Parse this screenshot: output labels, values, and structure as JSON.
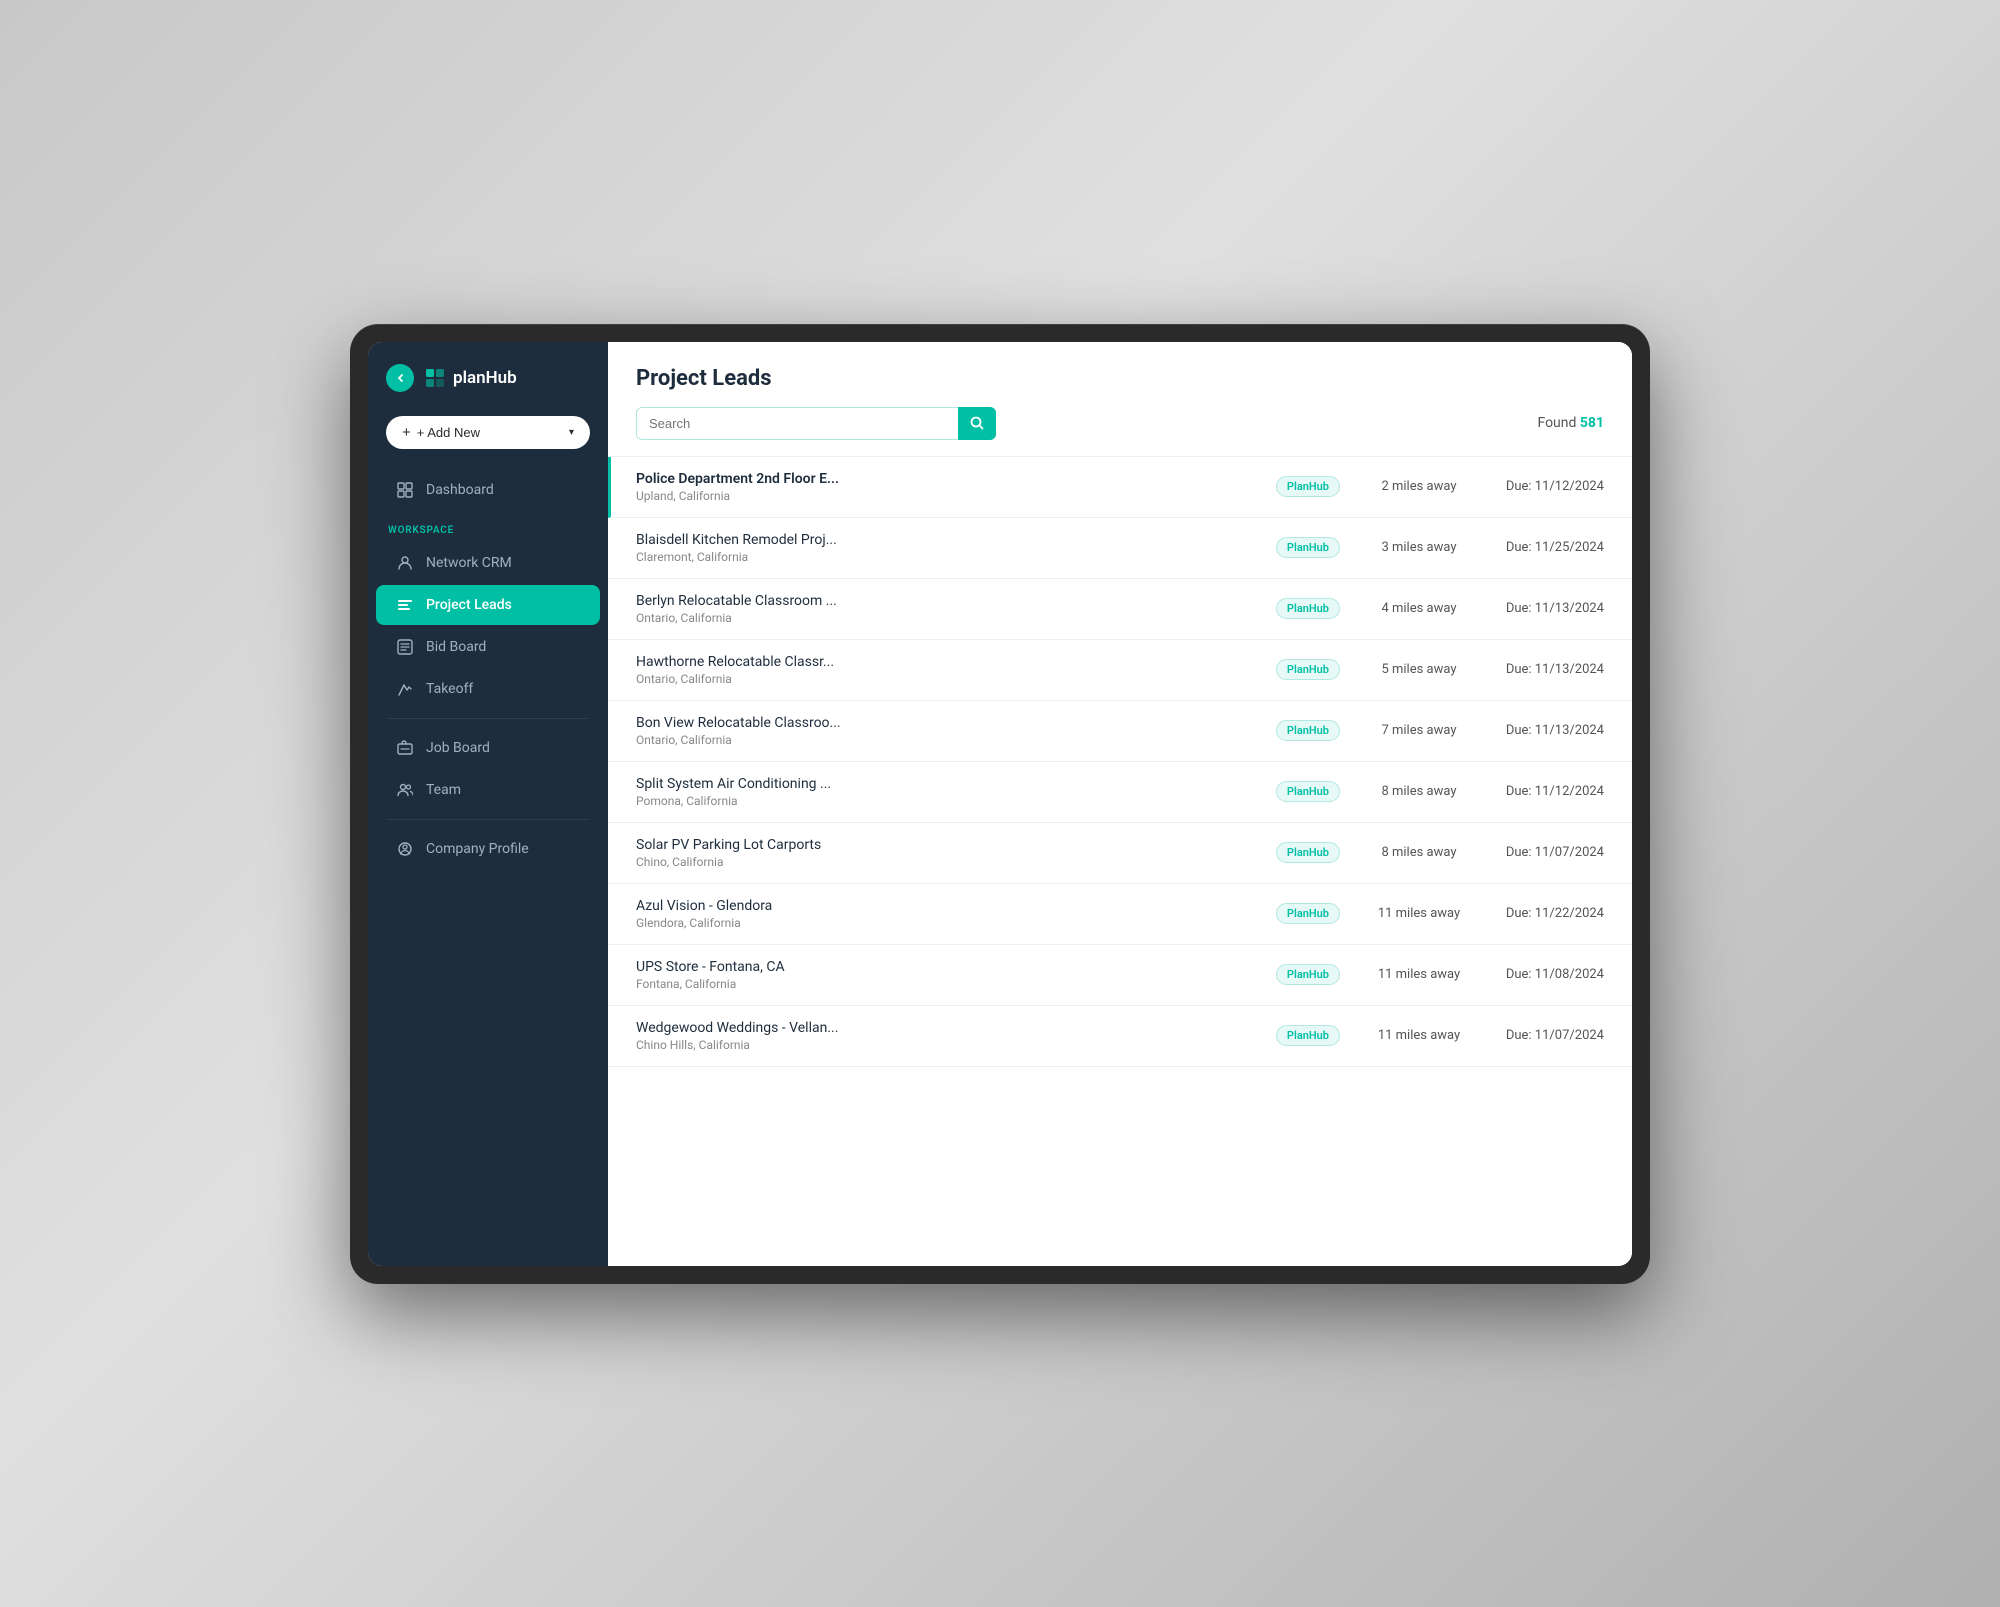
{
  "app": {
    "name": "planHub",
    "back_button_label": "back"
  },
  "add_new_button": {
    "label": "+ Add New"
  },
  "sidebar": {
    "workspace_label": "WORKSPACE",
    "items": [
      {
        "id": "dashboard",
        "label": "Dashboard",
        "active": false
      },
      {
        "id": "network-crm",
        "label": "Network CRM",
        "active": false
      },
      {
        "id": "project-leads",
        "label": "Project Leads",
        "active": true
      },
      {
        "id": "bid-board",
        "label": "Bid Board",
        "active": false
      },
      {
        "id": "takeoff",
        "label": "Takeoff",
        "active": false
      },
      {
        "id": "job-board",
        "label": "Job Board",
        "active": false
      },
      {
        "id": "team",
        "label": "Team",
        "active": false
      },
      {
        "id": "company-profile",
        "label": "Company Profile",
        "active": false
      }
    ]
  },
  "page": {
    "title": "Project Leads",
    "search_placeholder": "Search",
    "found_label": "Found",
    "found_count": "581"
  },
  "leads": [
    {
      "name": "Police Department 2nd Floor E...",
      "location": "Upland, California",
      "badge": "PlanHub",
      "distance": "2 miles away",
      "due": "Due: 11/12/2024",
      "highlighted": true
    },
    {
      "name": "Blaisdell Kitchen Remodel Proj...",
      "location": "Claremont, California",
      "badge": "PlanHub",
      "distance": "3 miles away",
      "due": "Due: 11/25/2024",
      "highlighted": false
    },
    {
      "name": "Berlyn Relocatable Classroom ...",
      "location": "Ontario, California",
      "badge": "PlanHub",
      "distance": "4 miles away",
      "due": "Due: 11/13/2024",
      "highlighted": false
    },
    {
      "name": "Hawthorne Relocatable Classr...",
      "location": "Ontario, California",
      "badge": "PlanHub",
      "distance": "5 miles away",
      "due": "Due: 11/13/2024",
      "highlighted": false
    },
    {
      "name": "Bon View Relocatable Classroo...",
      "location": "Ontario, California",
      "badge": "PlanHub",
      "distance": "7 miles away",
      "due": "Due: 11/13/2024",
      "highlighted": false
    },
    {
      "name": "Split System Air Conditioning ...",
      "location": "Pomona, California",
      "badge": "PlanHub",
      "distance": "8 miles away",
      "due": "Due: 11/12/2024",
      "highlighted": false
    },
    {
      "name": "Solar PV Parking Lot Carports",
      "location": "Chino, California",
      "badge": "PlanHub",
      "distance": "8 miles away",
      "due": "Due: 11/07/2024",
      "highlighted": false
    },
    {
      "name": "Azul Vision - Glendora",
      "location": "Glendora, California",
      "badge": "PlanHub",
      "distance": "11 miles away",
      "due": "Due: 11/22/2024",
      "highlighted": false
    },
    {
      "name": "UPS Store - Fontana, CA",
      "location": "Fontana, California",
      "badge": "PlanHub",
      "distance": "11 miles away",
      "due": "Due: 11/08/2024",
      "highlighted": false
    },
    {
      "name": "Wedgewood Weddings - Vellan...",
      "location": "Chino Hills, California",
      "badge": "PlanHub",
      "distance": "11 miles away",
      "due": "Due: 11/07/2024",
      "highlighted": false
    }
  ]
}
